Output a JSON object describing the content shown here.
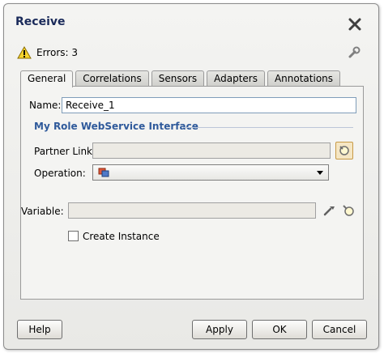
{
  "dialog": {
    "title": "Receive"
  },
  "status": {
    "errors_text": "Errors: 3"
  },
  "tabs": [
    {
      "label": "General",
      "active": true
    },
    {
      "label": "Correlations",
      "active": false
    },
    {
      "label": "Sensors",
      "active": false
    },
    {
      "label": "Adapters",
      "active": false
    },
    {
      "label": "Annotations",
      "active": false
    }
  ],
  "general": {
    "name_label": "Name:",
    "name_value": "Receive_1",
    "group_title": "My Role WebService Interface",
    "partner_link_label": "Partner Link:",
    "partner_link_value": "",
    "operation_label": "Operation:",
    "operation_value": "",
    "variable_label": "Variable:",
    "variable_value": "",
    "create_instance_label": "Create Instance",
    "create_instance_checked": false
  },
  "buttons": {
    "help": "Help",
    "apply": "Apply",
    "ok": "OK",
    "cancel": "Cancel"
  },
  "colors": {
    "title": "#1a2a5a",
    "group_title": "#2f5a9b",
    "field_border": "#7f9db9"
  }
}
